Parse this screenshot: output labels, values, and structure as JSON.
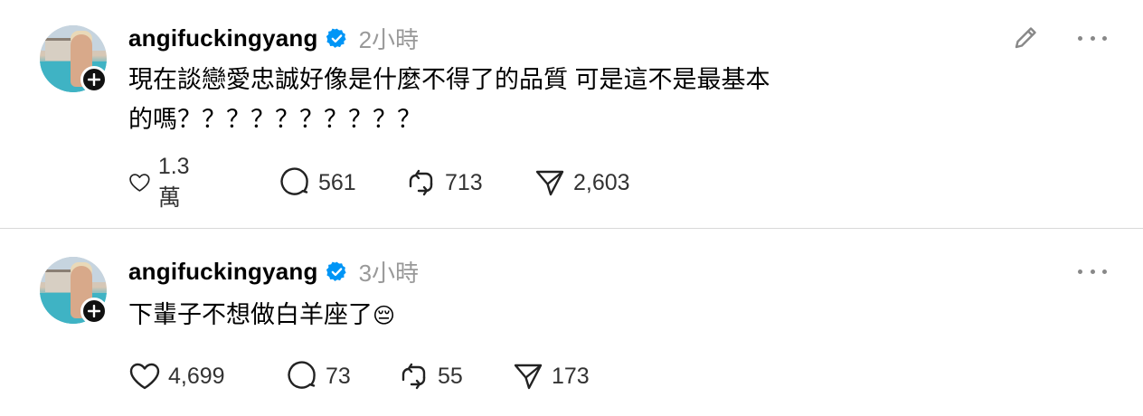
{
  "posts": [
    {
      "username": "angifuckingyang",
      "time": "2小時",
      "text_lines": [
        "現在談戀愛忠誠好像是什麼不得了的品質 可是這不是最基本",
        "的嗎？？？？？？？？？？"
      ],
      "likes": "1.3 萬",
      "replies": "561",
      "reposts": "713",
      "shares": "2,603"
    },
    {
      "username": "angifuckingyang",
      "time": "3小時",
      "text": "下輩子不想做白羊座了",
      "emoji": "😔",
      "likes": "4,699",
      "replies": "73",
      "reposts": "55",
      "shares": "173"
    }
  ],
  "icons": {
    "verified": "verified-badge-icon",
    "follow": "plus-icon",
    "like": "heart-icon",
    "reply": "comment-bubble-icon",
    "repost": "repost-icon",
    "share": "send-icon",
    "edit": "pencil-icon",
    "more": "more-dots-icon"
  },
  "colors": {
    "verified_blue": "#0095f6",
    "time_gray": "#999999",
    "text": "#000000",
    "count": "#333333"
  }
}
